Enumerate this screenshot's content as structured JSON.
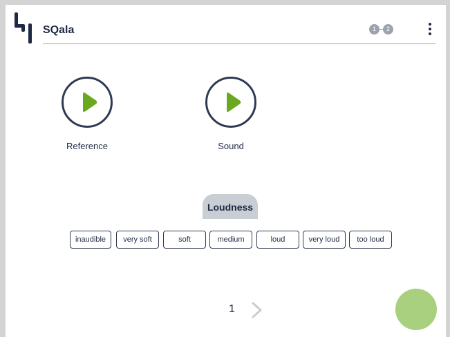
{
  "app": {
    "title": "SQala"
  },
  "header": {
    "steps": [
      "1",
      "2"
    ],
    "menu_icon": "vertical-dots-icon",
    "logo_icon": "sqala-logo-icon"
  },
  "players": [
    {
      "label": "Reference",
      "icon": "play-icon"
    },
    {
      "label": "Sound",
      "icon": "play-icon"
    }
  ],
  "question": {
    "title": "Loudness"
  },
  "options": [
    "inaudible",
    "very soft",
    "soft",
    "medium",
    "loud",
    "very loud",
    "too loud"
  ],
  "pagination": {
    "page": "1",
    "next_icon": "chevron-right-icon"
  },
  "fab": {
    "icon": "circle-button"
  },
  "colors": {
    "accent_green": "#6aa820",
    "fab_green": "#a8d07e",
    "navy": "#1e2a44",
    "tab_gray": "#c9cdd4",
    "step_gray": "#9ca3ae"
  }
}
